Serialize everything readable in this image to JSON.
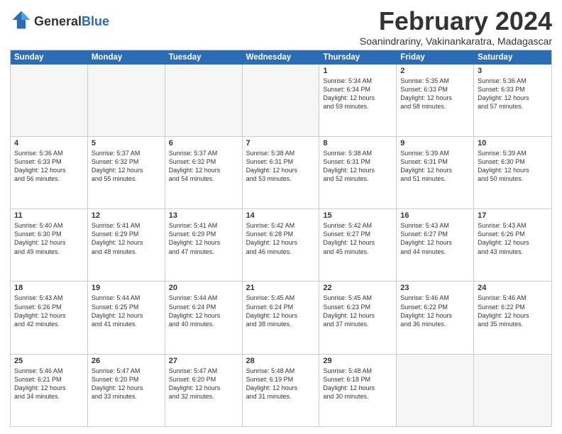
{
  "logo": {
    "general": "General",
    "blue": "Blue"
  },
  "title": "February 2024",
  "subtitle": "Soanindrariny, Vakinankaratra, Madagascar",
  "header_days": [
    "Sunday",
    "Monday",
    "Tuesday",
    "Wednesday",
    "Thursday",
    "Friday",
    "Saturday"
  ],
  "rows": [
    [
      {
        "day": "",
        "text": "",
        "empty": true
      },
      {
        "day": "",
        "text": "",
        "empty": true
      },
      {
        "day": "",
        "text": "",
        "empty": true
      },
      {
        "day": "",
        "text": "",
        "empty": true
      },
      {
        "day": "1",
        "text": "Sunrise: 5:34 AM\nSunset: 6:34 PM\nDaylight: 12 hours\nand 59 minutes.",
        "empty": false
      },
      {
        "day": "2",
        "text": "Sunrise: 5:35 AM\nSunset: 6:33 PM\nDaylight: 12 hours\nand 58 minutes.",
        "empty": false
      },
      {
        "day": "3",
        "text": "Sunrise: 5:36 AM\nSunset: 6:33 PM\nDaylight: 12 hours\nand 57 minutes.",
        "empty": false
      }
    ],
    [
      {
        "day": "4",
        "text": "Sunrise: 5:36 AM\nSunset: 6:33 PM\nDaylight: 12 hours\nand 56 minutes.",
        "empty": false
      },
      {
        "day": "5",
        "text": "Sunrise: 5:37 AM\nSunset: 6:32 PM\nDaylight: 12 hours\nand 55 minutes.",
        "empty": false
      },
      {
        "day": "6",
        "text": "Sunrise: 5:37 AM\nSunset: 6:32 PM\nDaylight: 12 hours\nand 54 minutes.",
        "empty": false
      },
      {
        "day": "7",
        "text": "Sunrise: 5:38 AM\nSunset: 6:31 PM\nDaylight: 12 hours\nand 53 minutes.",
        "empty": false
      },
      {
        "day": "8",
        "text": "Sunrise: 5:38 AM\nSunset: 6:31 PM\nDaylight: 12 hours\nand 52 minutes.",
        "empty": false
      },
      {
        "day": "9",
        "text": "Sunrise: 5:39 AM\nSunset: 6:31 PM\nDaylight: 12 hours\nand 51 minutes.",
        "empty": false
      },
      {
        "day": "10",
        "text": "Sunrise: 5:39 AM\nSunset: 6:30 PM\nDaylight: 12 hours\nand 50 minutes.",
        "empty": false
      }
    ],
    [
      {
        "day": "11",
        "text": "Sunrise: 5:40 AM\nSunset: 6:30 PM\nDaylight: 12 hours\nand 49 minutes.",
        "empty": false
      },
      {
        "day": "12",
        "text": "Sunrise: 5:41 AM\nSunset: 6:29 PM\nDaylight: 12 hours\nand 48 minutes.",
        "empty": false
      },
      {
        "day": "13",
        "text": "Sunrise: 5:41 AM\nSunset: 6:29 PM\nDaylight: 12 hours\nand 47 minutes.",
        "empty": false
      },
      {
        "day": "14",
        "text": "Sunrise: 5:42 AM\nSunset: 6:28 PM\nDaylight: 12 hours\nand 46 minutes.",
        "empty": false
      },
      {
        "day": "15",
        "text": "Sunrise: 5:42 AM\nSunset: 6:27 PM\nDaylight: 12 hours\nand 45 minutes.",
        "empty": false
      },
      {
        "day": "16",
        "text": "Sunrise: 5:43 AM\nSunset: 6:27 PM\nDaylight: 12 hours\nand 44 minutes.",
        "empty": false
      },
      {
        "day": "17",
        "text": "Sunrise: 5:43 AM\nSunset: 6:26 PM\nDaylight: 12 hours\nand 43 minutes.",
        "empty": false
      }
    ],
    [
      {
        "day": "18",
        "text": "Sunrise: 5:43 AM\nSunset: 6:26 PM\nDaylight: 12 hours\nand 42 minutes.",
        "empty": false
      },
      {
        "day": "19",
        "text": "Sunrise: 5:44 AM\nSunset: 6:25 PM\nDaylight: 12 hours\nand 41 minutes.",
        "empty": false
      },
      {
        "day": "20",
        "text": "Sunrise: 5:44 AM\nSunset: 6:24 PM\nDaylight: 12 hours\nand 40 minutes.",
        "empty": false
      },
      {
        "day": "21",
        "text": "Sunrise: 5:45 AM\nSunset: 6:24 PM\nDaylight: 12 hours\nand 38 minutes.",
        "empty": false
      },
      {
        "day": "22",
        "text": "Sunrise: 5:45 AM\nSunset: 6:23 PM\nDaylight: 12 hours\nand 37 minutes.",
        "empty": false
      },
      {
        "day": "23",
        "text": "Sunrise: 5:46 AM\nSunset: 6:22 PM\nDaylight: 12 hours\nand 36 minutes.",
        "empty": false
      },
      {
        "day": "24",
        "text": "Sunrise: 5:46 AM\nSunset: 6:22 PM\nDaylight: 12 hours\nand 35 minutes.",
        "empty": false
      }
    ],
    [
      {
        "day": "25",
        "text": "Sunrise: 5:46 AM\nSunset: 6:21 PM\nDaylight: 12 hours\nand 34 minutes.",
        "empty": false
      },
      {
        "day": "26",
        "text": "Sunrise: 5:47 AM\nSunset: 6:20 PM\nDaylight: 12 hours\nand 33 minutes.",
        "empty": false
      },
      {
        "day": "27",
        "text": "Sunrise: 5:47 AM\nSunset: 6:20 PM\nDaylight: 12 hours\nand 32 minutes.",
        "empty": false
      },
      {
        "day": "28",
        "text": "Sunrise: 5:48 AM\nSunset: 6:19 PM\nDaylight: 12 hours\nand 31 minutes.",
        "empty": false
      },
      {
        "day": "29",
        "text": "Sunrise: 5:48 AM\nSunset: 6:18 PM\nDaylight: 12 hours\nand 30 minutes.",
        "empty": false
      },
      {
        "day": "",
        "text": "",
        "empty": true
      },
      {
        "day": "",
        "text": "",
        "empty": true
      }
    ]
  ]
}
